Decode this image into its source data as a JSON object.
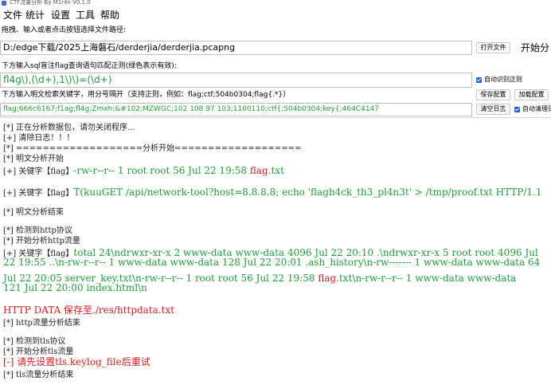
{
  "window": {
    "title": "CTF流量分析 By M1r4n V0.1.0"
  },
  "menu": [
    "文件",
    "统计",
    "设置",
    "工具",
    "帮助"
  ],
  "file_section": {
    "label": "拖拽、输入或者点击按钮选择文件路径:",
    "path": "D:/edge下载/2025上海磐石/derderjia/derderjia.pcapng",
    "open_button": "打开文件",
    "start_button": "开始分"
  },
  "regex_section": {
    "label": "下方输入sql盲注flag查询语句匹配正则(绿色表示有效):",
    "value": "fl4g\\),(\\d+),1\\)\\)=(\\d+)",
    "auto_regex_label": "自动识别正则"
  },
  "keyword_section": {
    "label": "下方输入明文检索关键字，用分号隔开（支持正则，例如：flag;ctf;504b0304;flag{.*}）",
    "save_button": "保存配置",
    "load_button": "加载配置",
    "value": "flag;666c6167;f1ag;fl4g;Zmxh;&#102;MZWGC;102 108 97 103;1100110;ctf{;504b0304;key{;464C4147",
    "clear_button": "清空日志",
    "auto_clear_label": "自动清理日"
  },
  "log": [
    {
      "t": "[*] 正在分析数据包，请勿关闭程序..."
    },
    {
      "t": "[+] 清除日志！！！"
    },
    {
      "t": "[*] ===================分析开始==================="
    },
    {
      "t": "[*] 明文分析开始"
    },
    {
      "p": "[+] 关键字【flag】",
      "g": "-rw-r--r-- 1 root root 56 Jul 22 19:58 ",
      "r": "flag",
      "g2": ".txt"
    },
    {
      "p": "[+] 关键字【flag】",
      "g": "T(kuuGET /api/network-tool?host=8.8.8.8; echo 'flagh4ck_th3_pl4n3t' > /tmp/proof.txt HTTP/1.1"
    },
    {
      "t": "[*] 明文分析结束"
    },
    {
      "t": "[*] 检测到http协议"
    },
    {
      "t": "[*] 开始分析http流量"
    },
    {
      "p": "[+] 关键字【flag】",
      "g": "total 24\\ndrwxr-xr-x 2 www-data www-data 4096 Jul 22 20:10 .\\ndrwxr-xr-x 5 root root 4096 Jul"
    },
    {
      "g": "22 19:55 ..\\n-rw-r--r-- 1 www-data www-data 128 Jul 22 20:01 .ash_history\\n-rw------- 1 www-data www-data 64"
    },
    {
      "g": "Jul 22 20:05 server_key.txt\\n-rw-r--r-- 1 root root 56 Jul 22 19:58 ",
      "r": "flag",
      "g2": ".txt\\n-rw-r--r-- 1 www-data www-data"
    },
    {
      "g": "121 Jul 22 20:00 index.html\\n"
    },
    {
      "rl": "HTTP DATA 保存至./res/httpdata.txt"
    },
    {
      "t": "[*] http流量分析结束"
    },
    {
      "t": "[*] 检测到tls协议"
    },
    {
      "t": "[*] 开始分析tls流量"
    },
    {
      "rl": "[-] 请先设置tls.keylog_file后重试"
    },
    {
      "t": "[*] tls流量分析结束"
    }
  ]
}
